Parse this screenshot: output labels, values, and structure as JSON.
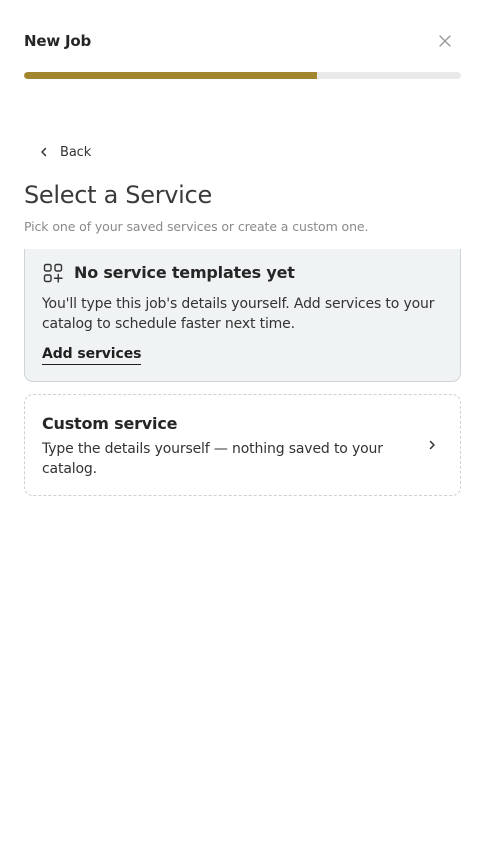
{
  "header": {
    "title": "New Job",
    "close_icon": "close-icon"
  },
  "progress": {
    "fraction": 0.67,
    "color": "#a2862d",
    "track_color": "#e9e9e9"
  },
  "nav": {
    "back_label": "Back",
    "back_icon": "chevron-left-icon"
  },
  "page": {
    "title": "Select a Service",
    "subtitle": "Pick one of your saved services or create a custom one."
  },
  "empty_state": {
    "icon": "grid-plus-icon",
    "title": "No service templates yet",
    "description": "You'll type this job's details yourself. Add services to your catalog to schedule faster next time.",
    "link_label": "Add services",
    "background": "#eff3f4"
  },
  "custom_service": {
    "title": "Custom service",
    "description": "Type the details yourself — nothing saved to your catalog.",
    "icon": "chevron-right-icon"
  }
}
